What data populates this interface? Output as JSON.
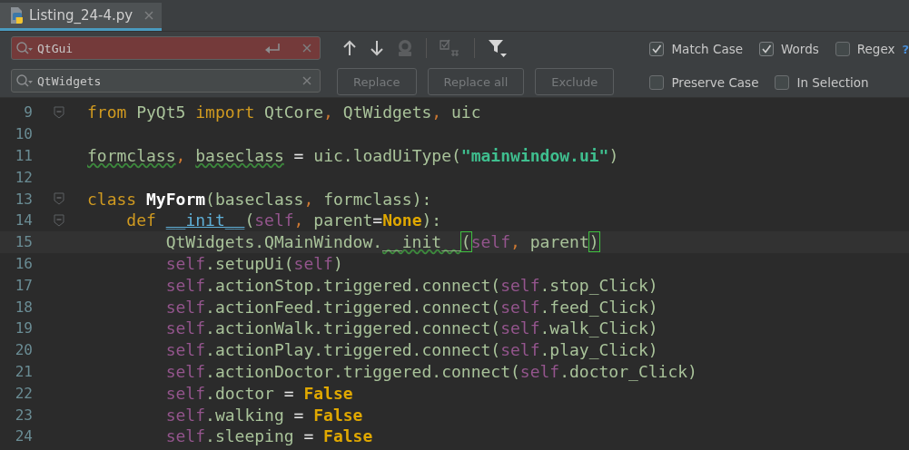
{
  "tabs": [
    {
      "label": "Listing_24-4.py",
      "selected": true
    }
  ],
  "find": {
    "value": "QtGui",
    "no_match": true
  },
  "replace": {
    "value": "QtWidgets"
  },
  "toolbar": [
    {
      "kind": "up"
    },
    {
      "kind": "down"
    },
    {
      "kind": "highlight"
    },
    {
      "kind": "select"
    },
    {
      "kind": "filter"
    }
  ],
  "buttons": [
    {
      "label": "Replace",
      "disabled": true
    },
    {
      "label": "Replace all",
      "disabled": true
    },
    {
      "label": "Exclude",
      "disabled": true
    }
  ],
  "options": [
    [
      {
        "label": "Match Case",
        "checked": true
      },
      {
        "label": "Words",
        "checked": true
      },
      {
        "label": "Regex",
        "checked": false
      }
    ],
    [
      {
        "label": "Preserve Case",
        "checked": false
      },
      {
        "label": "In Selection",
        "checked": false
      }
    ]
  ],
  "help": "?",
  "code": [
    {
      "number": "9",
      "foldable": true,
      "current": false,
      "tokens": [
        {
          "kind": "kw",
          "text": "from"
        },
        {
          "kind": "plain",
          "text": " PyQt5 "
        },
        {
          "kind": "kw",
          "text": "import"
        },
        {
          "kind": "plain",
          "text": " QtCore"
        },
        {
          "kind": "punct",
          "text": ", "
        },
        {
          "kind": "plain",
          "text": "QtWidgets"
        },
        {
          "kind": "punct",
          "text": ", "
        },
        {
          "kind": "plain",
          "text": "uic"
        }
      ]
    },
    {
      "number": "10",
      "foldable": false,
      "current": false
    },
    {
      "number": "11",
      "foldable": false,
      "current": false,
      "tokens": [
        {
          "kind": "warn",
          "text": "formclass"
        },
        {
          "kind": "punct",
          "text": ", "
        },
        {
          "kind": "warn",
          "text": "baseclass"
        },
        {
          "kind": "op",
          "text": " = "
        },
        {
          "kind": "plain",
          "text": "uic.loadUiType("
        },
        {
          "kind": "str",
          "text": "\"mainwindow.ui\""
        },
        {
          "kind": "plain",
          "text": ")"
        }
      ]
    },
    {
      "number": "12",
      "foldable": false,
      "current": false
    },
    {
      "number": "13",
      "foldable": true,
      "current": false,
      "tokens": [
        {
          "kind": "kw",
          "text": "class "
        },
        {
          "kind": "name",
          "text": "MyForm"
        },
        {
          "kind": "plain",
          "text": "(baseclass"
        },
        {
          "kind": "punct",
          "text": ", "
        },
        {
          "kind": "plain",
          "text": "formclass):"
        }
      ],
      "children": [
        {
          "number": "14",
          "foldable": true,
          "current": false,
          "tokens": [
            {
              "kind": "kw",
              "text": "def "
            },
            {
              "kind": "magic",
              "text": "__init__"
            },
            {
              "kind": "plain",
              "text": "("
            },
            {
              "kind": "self",
              "text": "self"
            },
            {
              "kind": "punct",
              "text": ", "
            },
            {
              "kind": "plain",
              "text": "parent"
            },
            {
              "kind": "op",
              "text": "="
            },
            {
              "kind": "const",
              "text": "None"
            },
            {
              "kind": "plain",
              "text": "):"
            }
          ],
          "children": [
            {
              "number": "15",
              "foldable": false,
              "current": true,
              "tokens": [
                {
                  "kind": "plain",
                  "text": "QtWidgets.QMainWindow."
                },
                {
                  "kind": "warn",
                  "text": "__init__"
                },
                {
                  "kind": "brace",
                  "text": "("
                },
                {
                  "kind": "self",
                  "text": "self"
                },
                {
                  "kind": "punct",
                  "text": ", "
                },
                {
                  "kind": "plain",
                  "text": "parent"
                },
                {
                  "kind": "brace",
                  "text": ")"
                }
              ]
            },
            {
              "number": "16",
              "foldable": false,
              "current": false,
              "tokens": [
                {
                  "kind": "self",
                  "text": "self"
                },
                {
                  "kind": "plain",
                  "text": ".setupUi("
                },
                {
                  "kind": "self",
                  "text": "self"
                },
                {
                  "kind": "plain",
                  "text": ")"
                }
              ]
            },
            {
              "number": "17",
              "foldable": false,
              "current": false,
              "tokens": [
                {
                  "kind": "self",
                  "text": "self"
                },
                {
                  "kind": "plain",
                  "text": ".actionStop.triggered.connect("
                },
                {
                  "kind": "self",
                  "text": "self"
                },
                {
                  "kind": "plain",
                  "text": ".stop_Click)"
                }
              ]
            },
            {
              "number": "18",
              "foldable": false,
              "current": false,
              "tokens": [
                {
                  "kind": "self",
                  "text": "self"
                },
                {
                  "kind": "plain",
                  "text": ".actionFeed.triggered.connect("
                },
                {
                  "kind": "self",
                  "text": "self"
                },
                {
                  "kind": "plain",
                  "text": ".feed_Click)"
                }
              ]
            },
            {
              "number": "19",
              "foldable": false,
              "current": false,
              "tokens": [
                {
                  "kind": "self",
                  "text": "self"
                },
                {
                  "kind": "plain",
                  "text": ".actionWalk.triggered.connect("
                },
                {
                  "kind": "self",
                  "text": "self"
                },
                {
                  "kind": "plain",
                  "text": ".walk_Click)"
                }
              ]
            },
            {
              "number": "20",
              "foldable": false,
              "current": false,
              "tokens": [
                {
                  "kind": "self",
                  "text": "self"
                },
                {
                  "kind": "plain",
                  "text": ".actionPlay.triggered.connect("
                },
                {
                  "kind": "self",
                  "text": "self"
                },
                {
                  "kind": "plain",
                  "text": ".play_Click)"
                }
              ]
            },
            {
              "number": "21",
              "foldable": false,
              "current": false,
              "tokens": [
                {
                  "kind": "self",
                  "text": "self"
                },
                {
                  "kind": "plain",
                  "text": ".actionDoctor.triggered.connect("
                },
                {
                  "kind": "self",
                  "text": "self"
                },
                {
                  "kind": "plain",
                  "text": ".doctor_Click)"
                }
              ]
            },
            {
              "number": "22",
              "foldable": false,
              "current": false,
              "tokens": [
                {
                  "kind": "self",
                  "text": "self"
                },
                {
                  "kind": "plain",
                  "text": ".doctor"
                },
                {
                  "kind": "op",
                  "text": " = "
                },
                {
                  "kind": "const",
                  "text": "False"
                }
              ]
            },
            {
              "number": "23",
              "foldable": false,
              "current": false,
              "tokens": [
                {
                  "kind": "self",
                  "text": "self"
                },
                {
                  "kind": "plain",
                  "text": ".walking"
                },
                {
                  "kind": "op",
                  "text": " = "
                },
                {
                  "kind": "const",
                  "text": "False"
                }
              ]
            },
            {
              "number": "24",
              "foldable": false,
              "current": false,
              "tokens": [
                {
                  "kind": "self",
                  "text": "self"
                },
                {
                  "kind": "plain",
                  "text": ".sleeping"
                },
                {
                  "kind": "op",
                  "text": " = "
                },
                {
                  "kind": "const",
                  "text": "False"
                }
              ]
            }
          ]
        }
      ]
    }
  ]
}
